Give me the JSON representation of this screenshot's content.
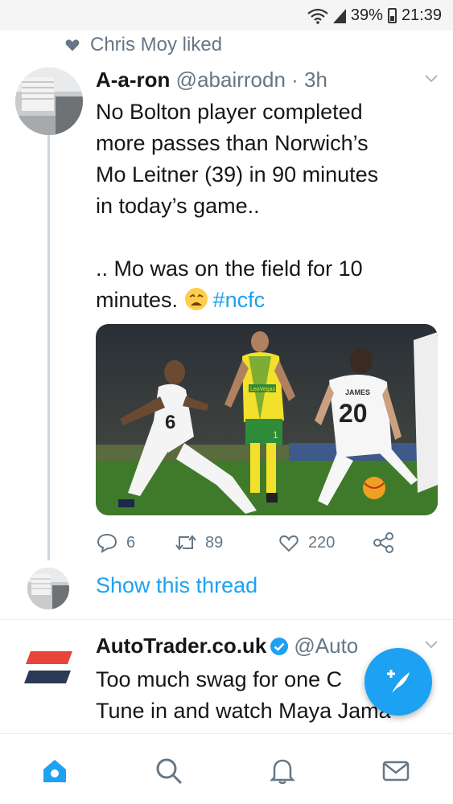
{
  "status_bar": {
    "battery": "39%",
    "time": "21:39"
  },
  "liked_by": "Chris Moy liked",
  "tweet": {
    "display_name": "A-a-ron",
    "handle_time": "@abairrodn · 3h",
    "text_lines": [
      "No Bolton player completed",
      "more passes than Norwich’s",
      "Mo Leitner (39) in 90 minutes",
      "in today’s game..",
      ".. Mo was on the field for 10",
      "minutes."
    ],
    "hashtag": "#ncfc",
    "emoji": "weary-face-emoji",
    "media_text": {
      "shirt_sponsor": "LeoVegas",
      "player_name": "JAMES",
      "player_number": "20",
      "left_number": "6",
      "center_partial": "1"
    },
    "actions": {
      "replies": "6",
      "retweets": "89",
      "likes": "220"
    }
  },
  "show_thread": "Show this thread",
  "promo": {
    "display_name": "AutoTrader.co.uk",
    "handle": "@Auto",
    "text_lines": [
      "Too much swag for one C",
      "Tune in and watch Maya Jama"
    ]
  },
  "icons": {
    "like_indicator": "heart-icon",
    "menu": "chevron-down-icon",
    "reply": "reply-icon",
    "retweet": "retweet-icon",
    "like": "like-icon",
    "share": "share-icon",
    "compose": "compose-icon",
    "nav": [
      "home-icon",
      "search-icon",
      "notifications-icon",
      "messages-icon"
    ]
  },
  "colors": {
    "accent": "#1da1f2",
    "secondary_text": "#657786",
    "autotrader_red": "#e8443a",
    "autotrader_navy": "#2b3a55"
  }
}
